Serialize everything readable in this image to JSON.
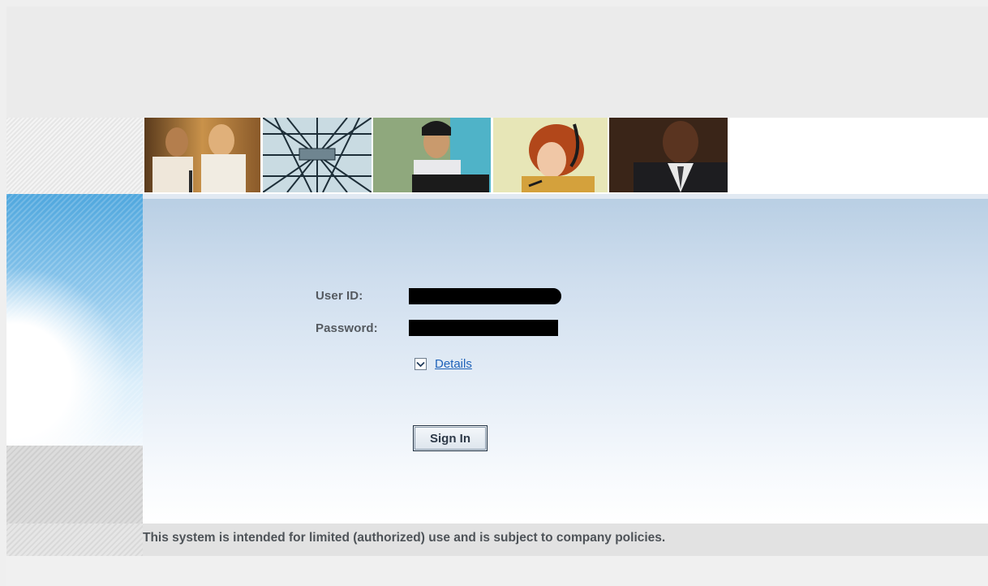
{
  "login": {
    "user_id_label": "User ID:",
    "password_label": "Password:",
    "details_link": "Details",
    "sign_in_button": "Sign In"
  },
  "footer": {
    "notice": "This system is intended for limited (authorized) use and is subject to company policies."
  },
  "colors": {
    "panel_top": "#b9cfe4",
    "link": "#1f62b9",
    "left_accent": "#4fa7de"
  },
  "icons": {
    "details_toggle": "chevron-down-icon"
  }
}
